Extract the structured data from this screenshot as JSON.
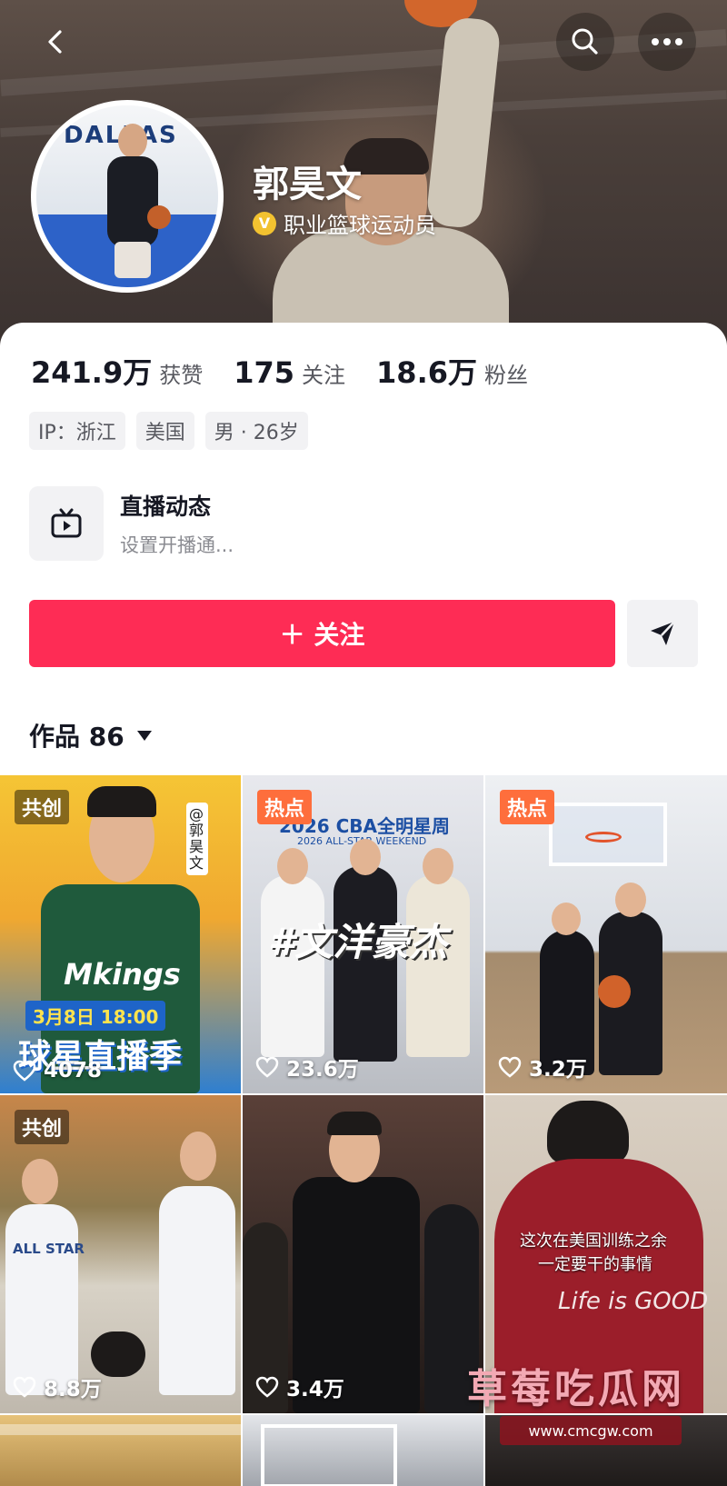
{
  "profile": {
    "name": "郭昊文",
    "verify_badge": "V",
    "verify_text": "职业篮球运动员",
    "avatar_logo_text": "DALLAS"
  },
  "stats": [
    {
      "num": "241.9万",
      "label": "获赞"
    },
    {
      "num": "175",
      "label": "关注"
    },
    {
      "num": "18.6万",
      "label": "粉丝"
    }
  ],
  "tags": [
    "IP：浙江",
    "美国",
    "男 · 26岁"
  ],
  "live": {
    "title": "直播动态",
    "subtitle": "设置开播通..."
  },
  "actions": {
    "follow_label": "＋ 关注"
  },
  "works": {
    "label": "作品 86"
  },
  "videos": [
    {
      "badge": "共创",
      "likes": "4078",
      "overlay": [
        "3月8日 18:00",
        "球星直播季",
        "Mkings",
        "@郭昊文"
      ]
    },
    {
      "badge": "热点",
      "likes": "23.6万",
      "overlay": [
        "#文洋豪杰",
        "2026 CBA全明星周",
        "2026 ALL-STAR WEEKEND"
      ]
    },
    {
      "badge": "热点",
      "likes": "3.2万",
      "overlay": []
    },
    {
      "badge": "共创",
      "likes": "8.8万",
      "overlay": [
        "ALL STAR"
      ]
    },
    {
      "badge": "",
      "likes": "3.4万",
      "overlay": []
    },
    {
      "badge": "",
      "likes": "",
      "overlay": [
        "这次在美国训练之余",
        "一定要干的事情",
        "Life is GOOD"
      ]
    }
  ],
  "watermark": {
    "title": "草莓吃瓜网",
    "url": "www.cmcgw.com"
  },
  "colors": {
    "accent": "#fe2c55",
    "hot": "#fe6e3c",
    "verify": "#f2c230"
  },
  "icons": [
    "back-icon",
    "search-icon",
    "more-icon",
    "live-tv-icon",
    "share-send-icon",
    "heart-icon",
    "dropdown-triangle-icon"
  ]
}
